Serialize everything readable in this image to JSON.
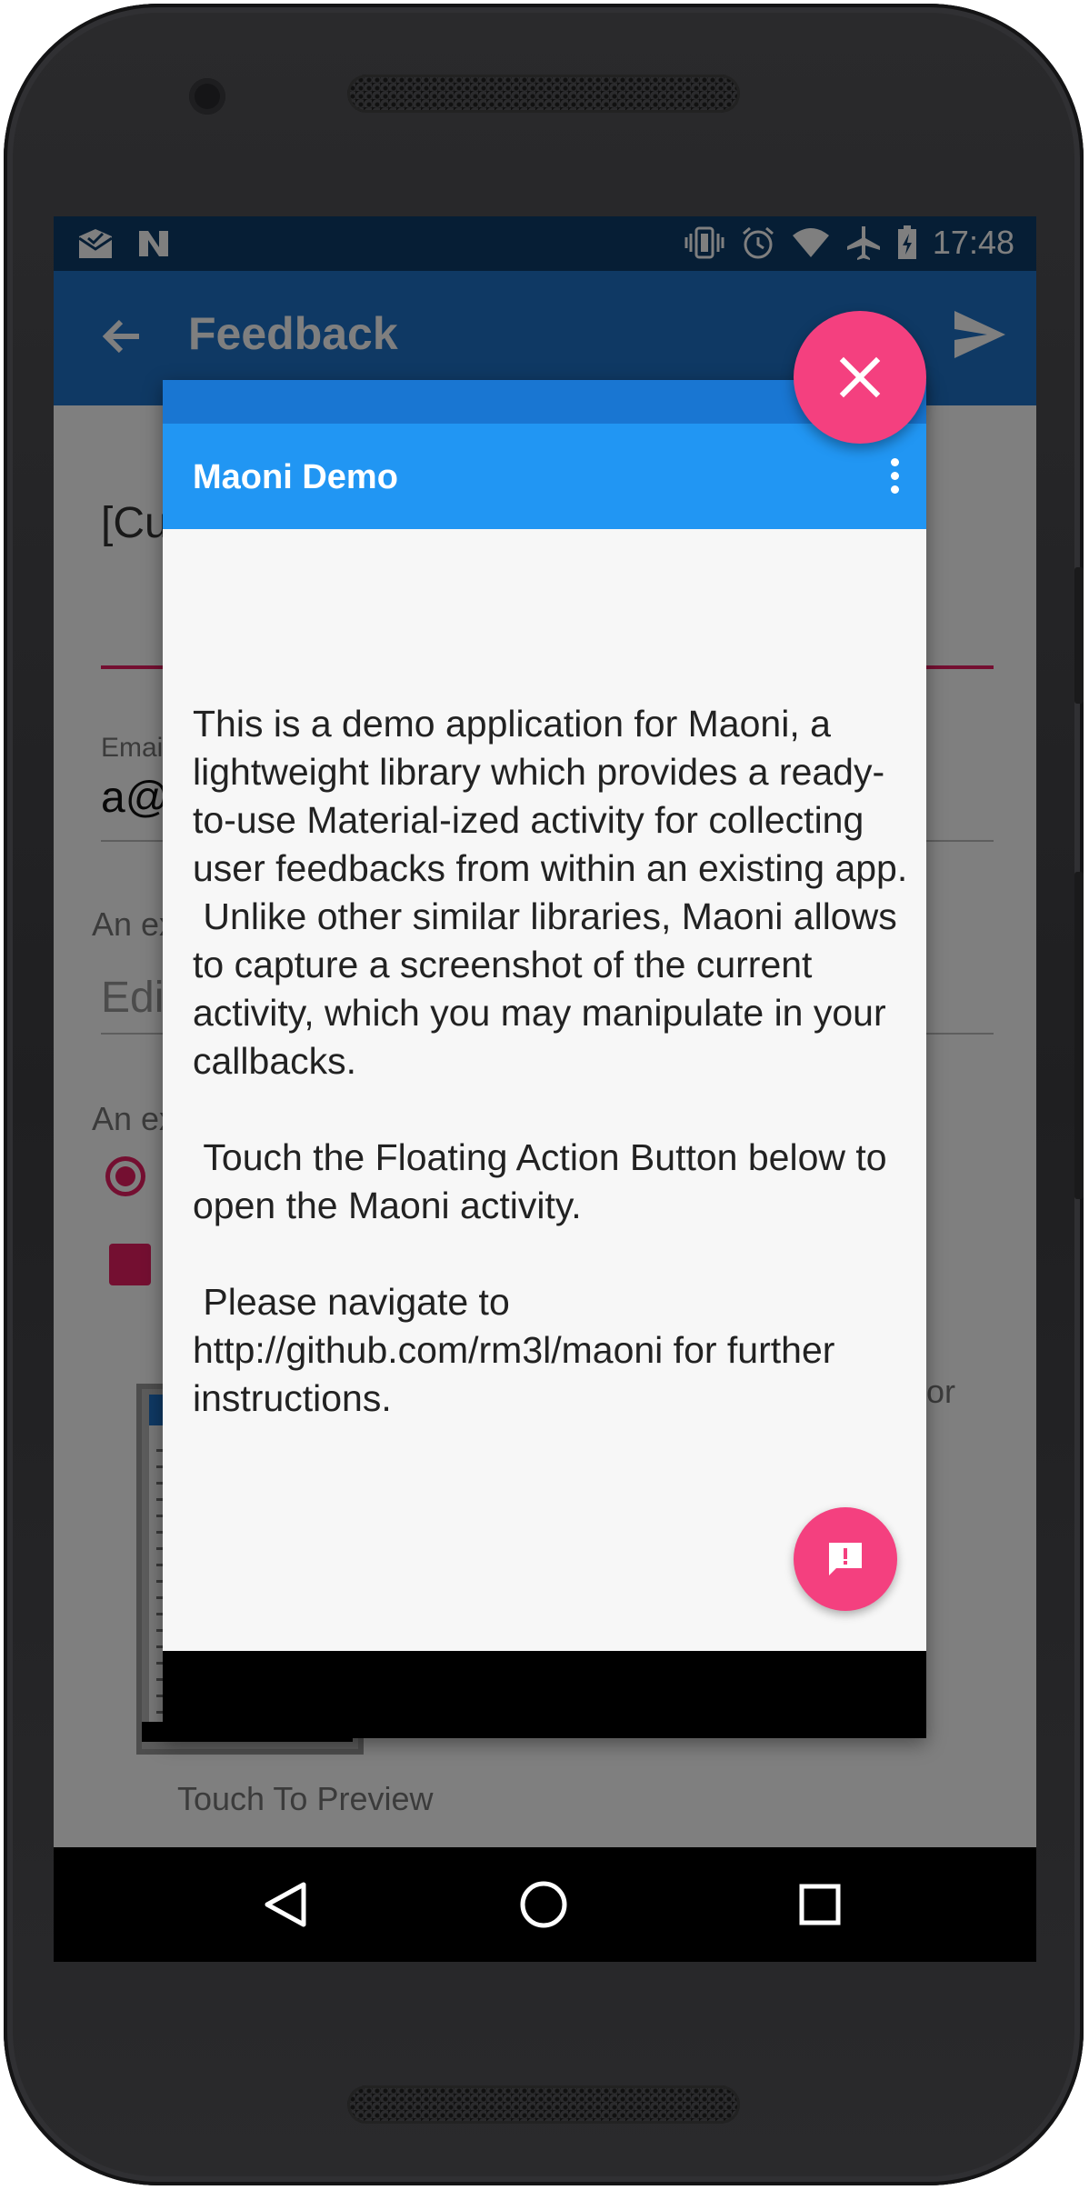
{
  "status_bar": {
    "time": "17:48",
    "left_icons": [
      "mail-check-icon",
      "n-icon"
    ],
    "right_icons": [
      "vibrate-icon",
      "alarm-icon",
      "wifi-icon",
      "airplane-icon",
      "battery-charging-icon"
    ]
  },
  "app_bar": {
    "title": "Feedback",
    "back_icon": "arrow-left-icon",
    "send_icon": "send-icon"
  },
  "background_form": {
    "title_partial": "[Cu",
    "email_hint": "Emai",
    "email_value": "a@",
    "hint_1": "An ex",
    "edit_partial": "Edi",
    "hint_2": "An ex",
    "side_text": "or",
    "touch_to_preview": "Touch To Preview"
  },
  "dialog": {
    "title": "Maoni Demo",
    "body": "This is a demo application for Maoni, a lightweight library which provides a ready-to-use Material-ized activity for collecting user feedbacks from within an existing app.\n Unlike other similar libraries, Maoni allows to capture a screenshot of the current activity, which you may manipulate in your callbacks.\n\n Touch the Floating Action Button below to open the Maoni activity.\n\n Please navigate to http://github.com/rm3l/maoni for further instructions.",
    "fab_icon": "feedback-icon"
  },
  "close_fab_icon": "close-icon",
  "navigation": {
    "back_icon": "nav-back-icon",
    "home_icon": "nav-home-icon",
    "recents_icon": "nav-recents-icon"
  },
  "colors": {
    "primary_dark": "#0d3c6a",
    "primary": "#1e72c9",
    "dialog_primary": "#2196f3",
    "accent": "#f4407f"
  }
}
